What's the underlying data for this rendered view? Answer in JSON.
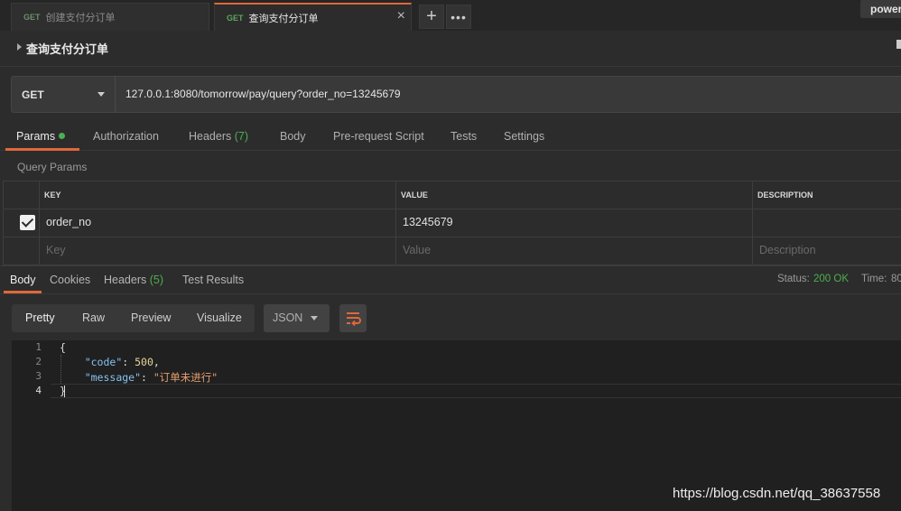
{
  "tabs": [
    {
      "method": "GET",
      "label": "创建支付分订单",
      "active": false
    },
    {
      "method": "GET",
      "label": "查询支付分订单",
      "active": true
    }
  ],
  "tab_close_icon": "×",
  "new_tab_icon": "+",
  "more_icon": "•••",
  "env_label": "power",
  "request": {
    "name": "查询支付分订单",
    "method": "GET",
    "url": "127.0.0.1:8080/tomorrow/pay/query?order_no=13245679"
  },
  "request_tabs": [
    {
      "label": "Params"
    },
    {
      "label": "Authorization"
    },
    {
      "label": "Headers",
      "count": "(7)"
    },
    {
      "label": "Body"
    },
    {
      "label": "Pre-request Script"
    },
    {
      "label": "Tests"
    },
    {
      "label": "Settings"
    }
  ],
  "query_params_label": "Query Params",
  "params_table": {
    "headers": [
      "KEY",
      "VALUE",
      "DESCRIPTION"
    ],
    "rows": [
      {
        "checked": true,
        "key": "order_no",
        "value": "13245679",
        "description": ""
      }
    ],
    "placeholder": {
      "key": "Key",
      "value": "Value",
      "description": "Description"
    }
  },
  "response_tabs": [
    {
      "label": "Body"
    },
    {
      "label": "Cookies"
    },
    {
      "label": "Headers",
      "count": "(5)"
    },
    {
      "label": "Test Results"
    }
  ],
  "status": {
    "label": "Status:",
    "value": "200 OK",
    "time_label": "Time:",
    "time_value": "80"
  },
  "format_buttons": [
    "Pretty",
    "Raw",
    "Preview",
    "Visualize"
  ],
  "format_select": "JSON",
  "code": {
    "line_numbers": [
      "1",
      "2",
      "3",
      "4"
    ],
    "open_brace": "{",
    "close_brace": "}",
    "key1": "\"code\"",
    "val1": "500",
    "key2": "\"message\"",
    "val2": "\"订单未进行\""
  },
  "watermark": "https://blog.csdn.net/qq_38637558",
  "colors": {
    "accent": "#e0673a",
    "success": "#4caf50",
    "background": "#2c2c2c"
  }
}
